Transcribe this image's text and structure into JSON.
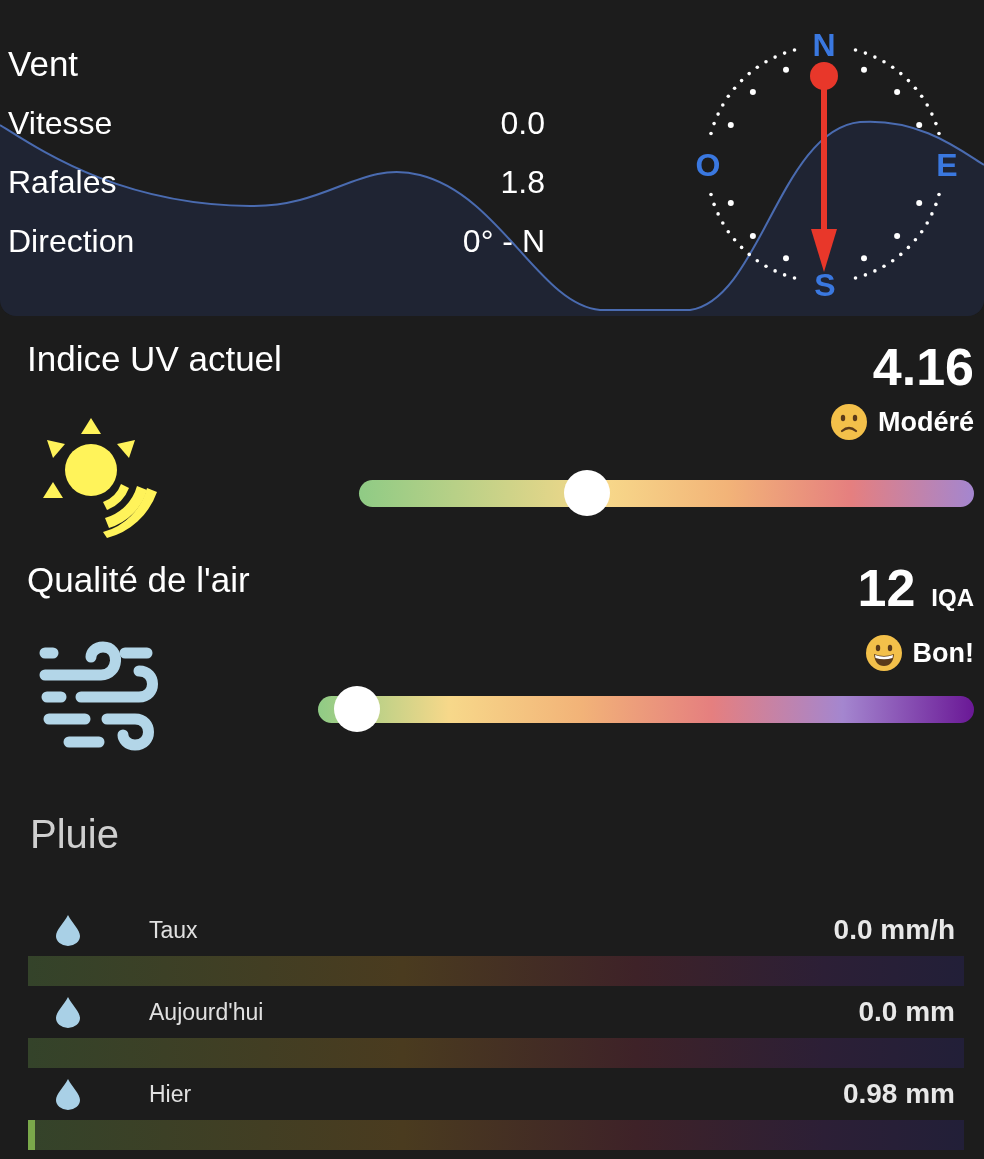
{
  "wind": {
    "title": "Vent",
    "rows": [
      {
        "label": "Vitesse",
        "value": "0.0"
      },
      {
        "label": "Rafales",
        "value": "1.8"
      },
      {
        "label": "Direction",
        "value": "0° - N"
      }
    ],
    "compass": {
      "north": "N",
      "east": "E",
      "south": "S",
      "west": "O"
    }
  },
  "gauges": [
    {
      "kind": "uv",
      "title": "Indice UV actuel",
      "value": "4.16",
      "rating": "Modéré",
      "level": 0.37
    },
    {
      "kind": "aqi",
      "title": "Qualité de l'air",
      "value": "12",
      "unit": "IQA",
      "rating": "Bon!",
      "level": 0.06
    }
  ],
  "rain": {
    "title": "Pluie",
    "rows": [
      {
        "label": "Taux",
        "value": "0.0 mm/h",
        "level": 0
      },
      {
        "label": "Aujourd'hui",
        "value": "0.0 mm",
        "level": 0
      },
      {
        "label": "Hier",
        "value": "0.98 mm",
        "level": 0.008
      }
    ]
  }
}
